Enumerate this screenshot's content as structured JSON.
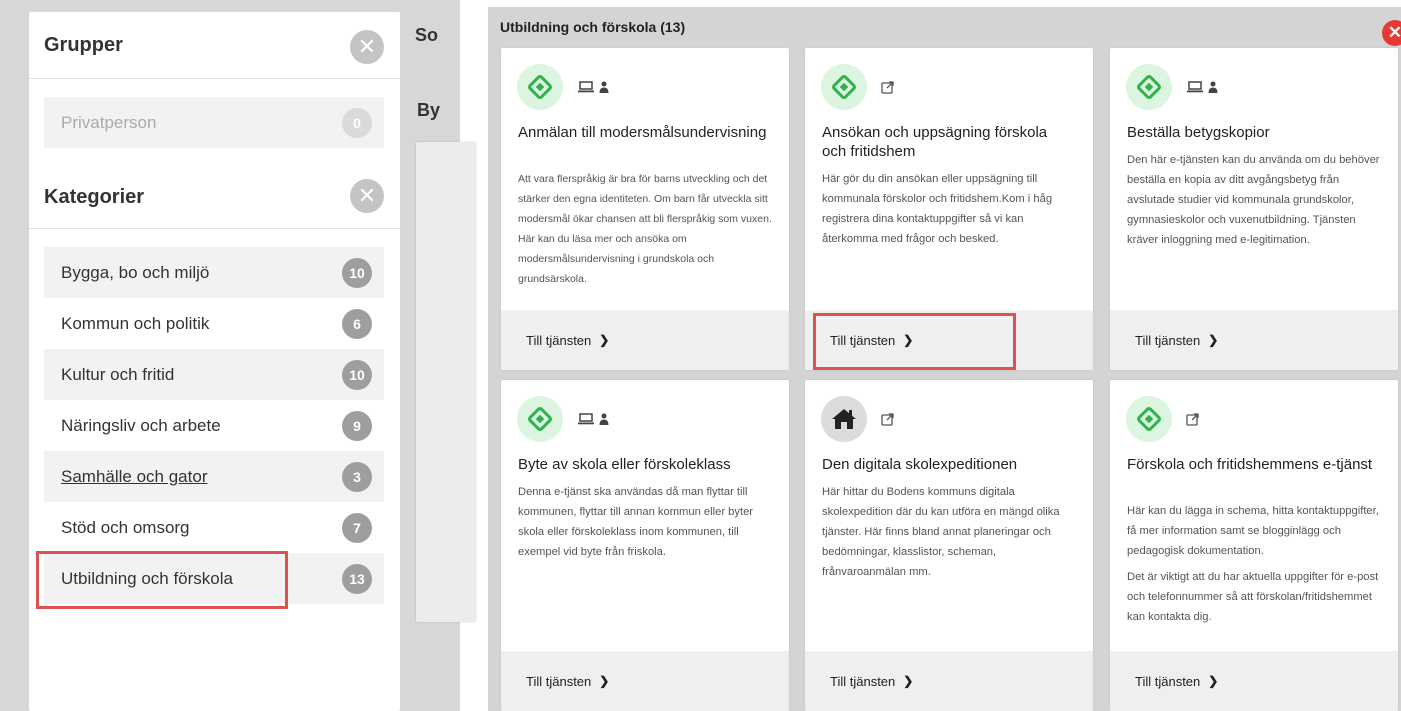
{
  "left": {
    "peek_text_1": "So",
    "peek_text_2": "By",
    "groups_heading": "Grupper",
    "groups": [
      {
        "label": "Privatperson",
        "count": "0"
      }
    ],
    "categories_heading": "Kategorier",
    "categories": [
      {
        "label": "Bygga, bo och miljö",
        "count": "10"
      },
      {
        "label": "Kommun och politik",
        "count": "6"
      },
      {
        "label": "Kultur och fritid",
        "count": "10"
      },
      {
        "label": "Näringsliv och arbete",
        "count": "9"
      },
      {
        "label": "Samhälle och gator",
        "count": "3"
      },
      {
        "label": "Stöd och omsorg",
        "count": "7"
      },
      {
        "label": "Utbildning och förskola",
        "count": "13"
      }
    ],
    "close_glyph": "✕"
  },
  "right": {
    "title": "Utbildning och förskola (13)",
    "close_glyph": "✕",
    "cards": [
      {
        "title": "Anmälan till modersmålsundervisning",
        "description": "Att vara flerspråkig är bra för barns utveckling och det stärker den egna identiteten. Om barn får utveckla sitt modersmål ökar chansen att bli flerspråkig som vuxen. Här kan du läsa mer och ansöka om modersmålsundervisning i grundskola och grundsärskola.",
        "link_label": "Till tjänsten",
        "icons": [
          "logo-icon",
          "laptop-icon",
          "person-icon"
        ]
      },
      {
        "title": "Ansökan och uppsägning förskola och fritidshem",
        "description": "Här gör du din ansökan eller uppsägning till kommunala förskolor och fritidshem.Kom i håg registrera dina kontaktuppgifter så vi kan återkomma med frågor och besked.",
        "link_label": "Till tjänsten",
        "icons": [
          "logo-icon",
          "external-link-icon"
        ]
      },
      {
        "title": "Beställa betygskopior",
        "description": "Den här e-tjänsten kan du använda om du behöver beställa en kopia av ditt avgångsbetyg från avslutade studier vid kommunala grundskolor, gymnasieskolor och vuxenutbildning. Tjänsten kräver inloggning med e-legitimation.",
        "link_label": "Till tjänsten",
        "icons": [
          "logo-icon",
          "laptop-icon",
          "person-icon"
        ]
      },
      {
        "title": "Byte av skola eller förskoleklass",
        "description": "Denna e-tjänst ska användas då man flyttar till kommunen, flyttar till annan kommun eller byter skola eller förskoleklass inom kommunen, till exempel vid byte från friskola.",
        "link_label": "Till tjänsten",
        "icons": [
          "logo-icon",
          "laptop-icon",
          "person-icon"
        ]
      },
      {
        "title": "Den digitala skolexpeditionen",
        "description": "Här hittar du Bodens kommuns digitala skolexpedition där du kan utföra en mängd olika tjänster. Här finns bland annat planeringar och bedömningar, klasslistor, scheman, frånvaroanmälan mm.",
        "link_label": "Till tjänsten",
        "icons": [
          "house-icon",
          "external-link-icon"
        ]
      },
      {
        "title": "Förskola och fritidshemmens e-tjänst",
        "description": "Här kan du lägga in schema, hitta kontaktuppgifter, få mer information samt se blogginlägg och pedagogisk dokumentation.",
        "description_2": "Det är viktigt att du har aktuella uppgifter för e-post och telefonnummer så att förskolan/fritidshemmet kan kontakta dig.",
        "link_label": "Till tjänsten",
        "icons": [
          "logo-icon",
          "external-link-icon"
        ]
      }
    ]
  },
  "colors": {
    "accent_green": "#2fb24c",
    "highlight_red": "#d9534f",
    "close_red": "#e53935",
    "badge_gray": "#9e9e9e"
  }
}
